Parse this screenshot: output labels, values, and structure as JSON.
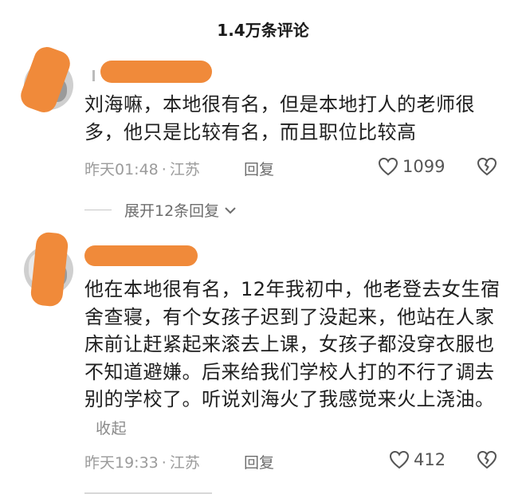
{
  "header": {
    "title": "1.4万条评论"
  },
  "comments": [
    {
      "text": "刘海嘛，本地很有名，但是本地打人的老师很多，他只是比较有名，而且职位比较高",
      "time": "昨天01:48",
      "location": "江苏",
      "reply_label": "回复",
      "likes": "1099",
      "collapse_label": ""
    },
    {
      "text": "他在本地很有名，12年我初中，他老登去女生宿舍查寝，有个女孩子迟到了没起来，他站在人家床前让赶紧起来滚去上课，女孩子都没穿衣服也不知道避嫌。后来给我们学校人打的不行了调去别的学校了。听说刘海火了我感觉来火上浇油。",
      "time": "昨天19:33",
      "location": "江苏",
      "reply_label": "回复",
      "likes": "412",
      "collapse_label": "收起"
    }
  ],
  "expand": {
    "label": "展开12条回复"
  },
  "colors": {
    "redaction": "#f08a3a",
    "meta": "#9b9b9b",
    "text": "#1f1f1f"
  },
  "icons": [
    "heart-outline-icon",
    "broken-heart-icon",
    "chevron-down-icon"
  ]
}
